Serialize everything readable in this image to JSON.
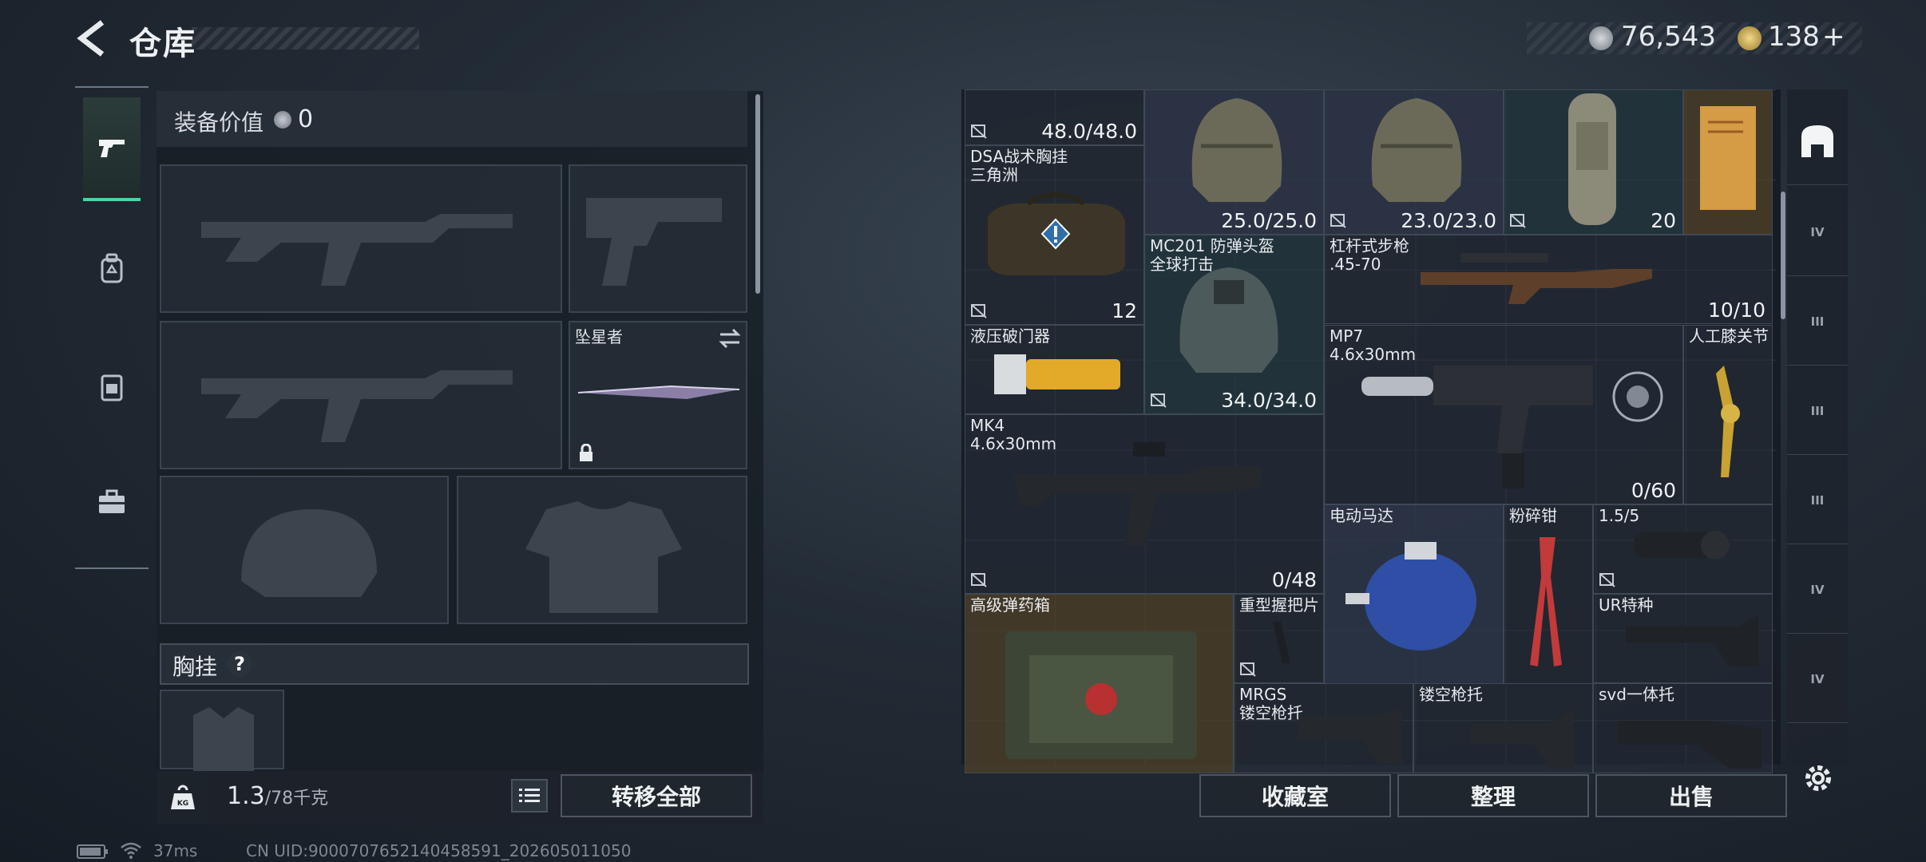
{
  "header": {
    "title": "仓库",
    "currency": [
      {
        "icon": "silver-coin-icon",
        "value": "76,543"
      },
      {
        "icon": "gold-coin-icon",
        "value": "138"
      }
    ],
    "add_label": "+"
  },
  "left_nav": {
    "tabs": [
      {
        "icon": "pistol-icon",
        "active": true
      },
      {
        "icon": "backpack-icon",
        "active": false
      },
      {
        "icon": "vest-icon",
        "active": false
      },
      {
        "icon": "toolbox-icon",
        "active": false
      }
    ]
  },
  "loadout": {
    "equip_value_label": "装备价值",
    "equip_value": "0",
    "melee_name": "坠星者",
    "chest_rig_section": "胸挂",
    "help": "?",
    "weight": "1.3",
    "weight_max": "/78千克",
    "transfer_all": "转移全部"
  },
  "status": {
    "ping": "37ms",
    "uid": "CN UID:9000707652140458591_202605011050"
  },
  "stash": {
    "items": [
      {
        "key": "top-left",
        "name": "",
        "qty": "48.0/48.0"
      },
      {
        "key": "dsa",
        "name": "DSA战术胸挂\n三角洲",
        "qty": "12"
      },
      {
        "key": "helmet1",
        "name": "",
        "qty": "25.0/25.0"
      },
      {
        "key": "helmet2",
        "name": "",
        "qty": "23.0/23.0"
      },
      {
        "key": "bag",
        "name": "",
        "qty": "20"
      },
      {
        "key": "mc201",
        "name": "MC201 防弹头盔\n全球打击",
        "qty": "34.0/34.0"
      },
      {
        "key": "lever",
        "name": "杠杆式步枪\n.45-70",
        "qty": "10/10"
      },
      {
        "key": "breacher",
        "name": "液压破门器",
        "qty": ""
      },
      {
        "key": "mp7",
        "name": "MP7\n4.6x30mm",
        "qty": "0/60"
      },
      {
        "key": "knee",
        "name": "人工膝关节",
        "qty": ""
      },
      {
        "key": "mk4",
        "name": "MK4\n4.6x30mm",
        "qty": "0/48"
      },
      {
        "key": "motor",
        "name": "电动马达",
        "qty": ""
      },
      {
        "key": "crusher",
        "name": "粉碎钳",
        "qty": ""
      },
      {
        "key": "scope",
        "name": "1.5/5",
        "qty": ""
      },
      {
        "key": "ammo",
        "name": "高级弹药箱",
        "qty": ""
      },
      {
        "key": "grip",
        "name": "重型握把片",
        "qty": ""
      },
      {
        "key": "urstock",
        "name": "UR特种",
        "qty": ""
      },
      {
        "key": "mrgs",
        "name": "MRGS\n镂空枪托",
        "qty": ""
      },
      {
        "key": "hollow",
        "name": "镂空枪托",
        "qty": ""
      },
      {
        "key": "svd",
        "name": "svd一体托",
        "qty": ""
      }
    ],
    "sidebar_tabs": [
      "IV",
      "III",
      "III",
      "III",
      "IV",
      "IV"
    ],
    "buttons": {
      "collection": "收藏室",
      "organize": "整理",
      "sell": "出售"
    }
  },
  "colors": {
    "accent_green": "#4fd1a5",
    "panel_bg": "#1a2029"
  }
}
